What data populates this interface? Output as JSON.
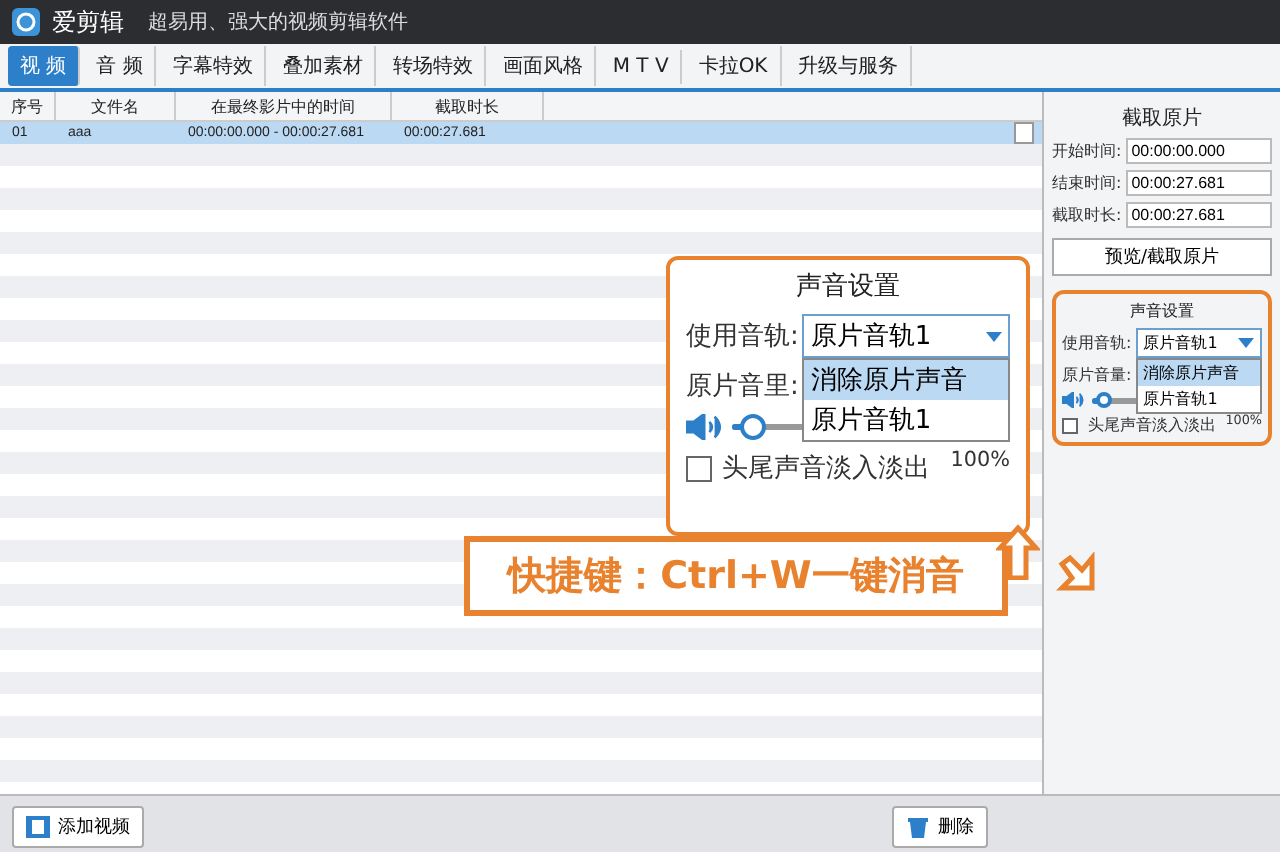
{
  "window": {
    "app_name": "爱剪辑",
    "tagline": "超易用、强大的视频剪辑软件"
  },
  "tabs": [
    {
      "label": "视 频",
      "selected": true
    },
    {
      "label": "音 频",
      "selected": false
    },
    {
      "label": "字幕特效",
      "selected": false
    },
    {
      "label": "叠加素材",
      "selected": false
    },
    {
      "label": "转场特效",
      "selected": false
    },
    {
      "label": "画面风格",
      "selected": false
    },
    {
      "label": "M T V",
      "selected": false
    },
    {
      "label": "卡拉OK",
      "selected": false
    },
    {
      "label": "升级与服务",
      "selected": false
    }
  ],
  "table": {
    "columns": [
      "序号",
      "文件名",
      "在最终影片中的时间",
      "截取时长"
    ],
    "rows": [
      {
        "cells": [
          "01",
          "aaa",
          "00:00:00.000 - 00:00:27.681",
          "00:00:27.681"
        ],
        "selected": true
      }
    ]
  },
  "clip_panel": {
    "title": "截取原片",
    "fields": [
      {
        "label": "开始时间:",
        "value": "00:00:00.000"
      },
      {
        "label": "结束时间:",
        "value": "00:00:27.681"
      },
      {
        "label": "截取时长:",
        "value": "00:00:27.681"
      }
    ],
    "button": "预览/截取原片"
  },
  "sound_panel": {
    "title": "声音设置",
    "track_label": "使用音轨:",
    "track_value": "原片音轨1",
    "options": [
      {
        "label": "消除原片声音",
        "selected": true
      },
      {
        "label": "原片音轨1",
        "selected": false
      }
    ],
    "volume_label": "原片音量:",
    "level": 0.1,
    "reading": "100%",
    "fade": {
      "label": "头尾声音淡入淡出",
      "checked": false
    }
  },
  "callout": {
    "title": "声音设置",
    "track_label": "使用音轨:",
    "track_value": "原片音轨1",
    "options": [
      {
        "label": "消除原片声音",
        "selected": true
      },
      {
        "label": "原片音轨1",
        "selected": false
      }
    ],
    "volume_label": "原片音里:",
    "level": 0.1,
    "reading": "100%",
    "fade": {
      "label": "头尾声音淡入淡出",
      "checked": false
    }
  },
  "shortcut_banner": {
    "text": "快捷键：Ctrl+W一键消音"
  },
  "bottom_bar": {
    "add_button": "添加视频",
    "delete_button": "删除"
  }
}
